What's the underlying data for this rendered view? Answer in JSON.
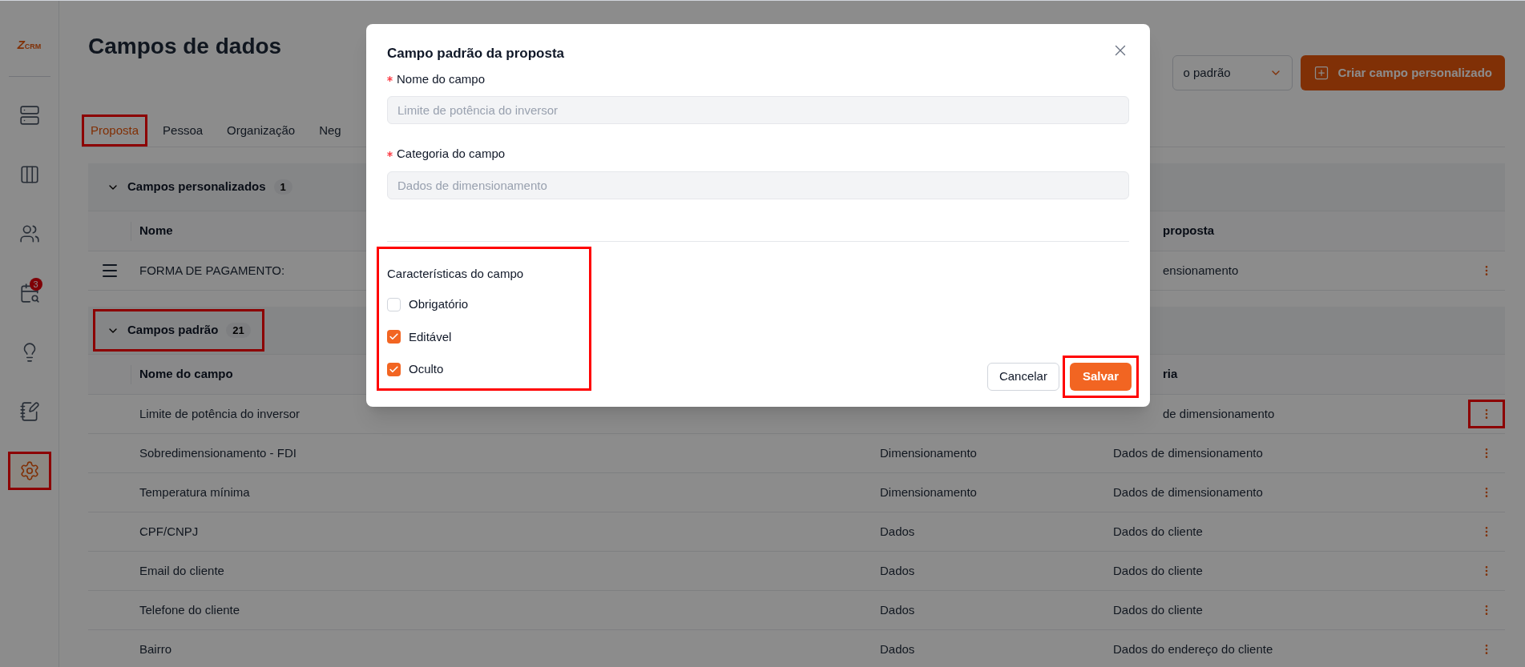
{
  "sidebar": {
    "logo": {
      "mark": "Z",
      "text": "CRM"
    },
    "items": [
      {
        "kind": "stack",
        "selected": false,
        "highlighted": false
      },
      {
        "kind": "columns",
        "selected": false,
        "highlighted": false
      },
      {
        "kind": "users",
        "selected": false,
        "highlighted": false
      },
      {
        "kind": "calendar",
        "selected": false,
        "highlighted": false,
        "badge": "3"
      },
      {
        "kind": "idea",
        "selected": false,
        "highlighted": false
      },
      {
        "kind": "note",
        "selected": false,
        "highlighted": false
      },
      {
        "kind": "settings",
        "selected": true,
        "highlighted": true
      }
    ]
  },
  "page": {
    "title": "Campos de dados",
    "select": {
      "value": "o padrão"
    },
    "create_button": "Criar campo personalizado"
  },
  "tabs": [
    {
      "label": "Proposta",
      "selected": true,
      "highlighted": true
    },
    {
      "label": "Pessoa",
      "selected": false,
      "highlighted": false
    },
    {
      "label": "Organização",
      "selected": false,
      "highlighted": false
    },
    {
      "label": "Neg",
      "selected": false,
      "highlighted": false
    }
  ],
  "sections": [
    {
      "title": "Campos personalizados",
      "count": "1",
      "expanded": true,
      "highlighted": false,
      "header_under_dialog": true,
      "columns": [
        "Nome",
        "",
        "proposta"
      ],
      "rows": [
        {
          "kind": "custom",
          "under_dialog": true,
          "cells": [
            "FORMA DE PAGAMENTO:",
            "",
            "ensionamento"
          ],
          "menu_highlighted": false
        }
      ]
    },
    {
      "title": "Campos padrão",
      "count": "21",
      "expanded": true,
      "highlighted": true,
      "header_under_dialog": true,
      "columns": [
        "Nome do campo",
        "",
        "ria"
      ],
      "rows": [
        {
          "kind": "standard",
          "under_dialog": true,
          "cells": [
            "Limite de potência do inversor",
            "",
            "de dimensionamento"
          ],
          "menu_highlighted": true
        },
        {
          "kind": "standard",
          "under_dialog": false,
          "cells": [
            "Sobredimensionamento - FDI",
            "Dimensionamento",
            "Dados de dimensionamento"
          ],
          "menu_highlighted": false
        },
        {
          "kind": "standard",
          "under_dialog": false,
          "cells": [
            "Temperatura mínima",
            "Dimensionamento",
            "Dados de dimensionamento"
          ],
          "menu_highlighted": false
        },
        {
          "kind": "standard",
          "under_dialog": false,
          "cells": [
            "CPF/CNPJ",
            "Dados",
            "Dados do cliente"
          ],
          "menu_highlighted": false
        },
        {
          "kind": "standard",
          "under_dialog": false,
          "cells": [
            "Email do cliente",
            "Dados",
            "Dados do cliente"
          ],
          "menu_highlighted": false
        },
        {
          "kind": "standard",
          "under_dialog": false,
          "cells": [
            "Telefone do cliente",
            "Dados",
            "Dados do cliente"
          ],
          "menu_highlighted": false
        },
        {
          "kind": "standard",
          "under_dialog": false,
          "cells": [
            "Bairro",
            "Dados",
            "Dados do endereço do cliente"
          ],
          "menu_highlighted": false
        }
      ]
    }
  ],
  "dialog": {
    "title": "Campo padrão da proposta",
    "fields": [
      {
        "label": "Nome do campo",
        "required": true,
        "placeholder": "Limite de potência do inversor"
      },
      {
        "label": "Categoria do campo",
        "required": true,
        "placeholder": "Dados de dimensionamento"
      }
    ],
    "characteristics": {
      "title": "Características do campo",
      "highlighted": true,
      "options": [
        {
          "label": "Obrigatório",
          "checked": false
        },
        {
          "label": "Editável",
          "checked": true
        },
        {
          "label": "Oculto",
          "checked": true
        }
      ]
    },
    "cancel_button": "Cancelar",
    "save_button": {
      "label": "Salvar",
      "highlighted": true
    }
  }
}
